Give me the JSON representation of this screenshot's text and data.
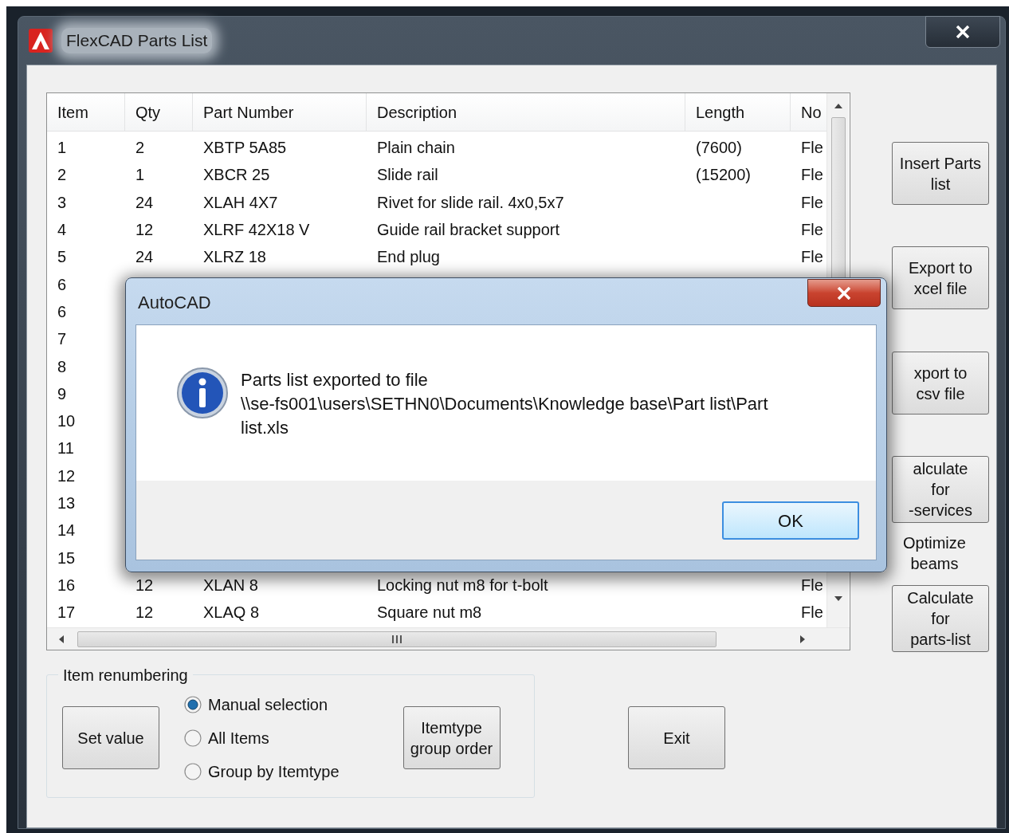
{
  "window": {
    "title": "FlexCAD Parts List"
  },
  "table": {
    "columns": [
      "Item",
      "Qty",
      "Part Number",
      "Description",
      "Length",
      "No"
    ],
    "rows": [
      {
        "item": "1",
        "qty": "2",
        "part_number": "XBTP 5A85",
        "description": "Plain chain",
        "length": "(7600)",
        "column_6": "Fle"
      },
      {
        "item": "2",
        "qty": "1",
        "part_number": "XBCR 25",
        "description": "Slide rail",
        "length": "(15200)",
        "column_6": "Fle"
      },
      {
        "item": "3",
        "qty": "24",
        "part_number": "XLAH 4X7",
        "description": "Rivet for slide rail. 4x0,5x7",
        "column_6": "Fle"
      },
      {
        "item": "4",
        "qty": "12",
        "part_number": "XLRF 42X18 V",
        "description": "Guide rail bracket support",
        "column_6": "Fle"
      },
      {
        "item": "5",
        "qty": "24",
        "part_number": "XLRZ 18",
        "description": "End plug",
        "column_6": "Fle"
      },
      {
        "item": "6"
      },
      {
        "item": "6"
      },
      {
        "item": "7"
      },
      {
        "item": "8"
      },
      {
        "item": "9"
      },
      {
        "item": "10"
      },
      {
        "item": "11"
      },
      {
        "item": "12"
      },
      {
        "item": "13"
      },
      {
        "item": "14"
      },
      {
        "item": "15"
      },
      {
        "item": "16",
        "qty": "12",
        "part_number": "XLAN 8",
        "description": "Locking nut m8 for t-bolt",
        "column_6": "Fle"
      },
      {
        "item": "17",
        "qty": "12",
        "part_number": "XLAQ 8",
        "description": "Square nut m8",
        "column_6": "Fle"
      }
    ]
  },
  "side_buttons": [
    {
      "kind": "button",
      "lines": [
        "Insert Parts",
        "list"
      ]
    },
    {
      "kind": "button",
      "lines": [
        "Export to",
        "xcel file"
      ]
    },
    {
      "kind": "button",
      "lines": [
        "xport to",
        "csv file"
      ]
    },
    {
      "kind": "button",
      "lines": [
        "alculate",
        "for",
        "-services"
      ]
    },
    {
      "kind": "label",
      "lines": [
        "Optimize",
        "beams"
      ]
    },
    {
      "kind": "button",
      "lines": [
        "Calculate",
        "for",
        "parts-list"
      ]
    }
  ],
  "renumbering": {
    "title": "Item renumbering",
    "set_button": "Set value",
    "options": [
      {
        "label": "Manual selection",
        "selected": true
      },
      {
        "label": "All Items",
        "selected": false
      },
      {
        "label": "Group by Itemtype",
        "selected": false
      }
    ],
    "order_button": [
      "Itemtype",
      "group order"
    ]
  },
  "exit_button": "Exit",
  "dialog": {
    "title": "AutoCAD",
    "message_lines": [
      "Parts list exported to file",
      "\\\\se-fs001\\users\\SETHN0\\Documents\\Knowledge base\\Part list\\Part",
      "list.xls"
    ],
    "ok_button": "OK"
  }
}
